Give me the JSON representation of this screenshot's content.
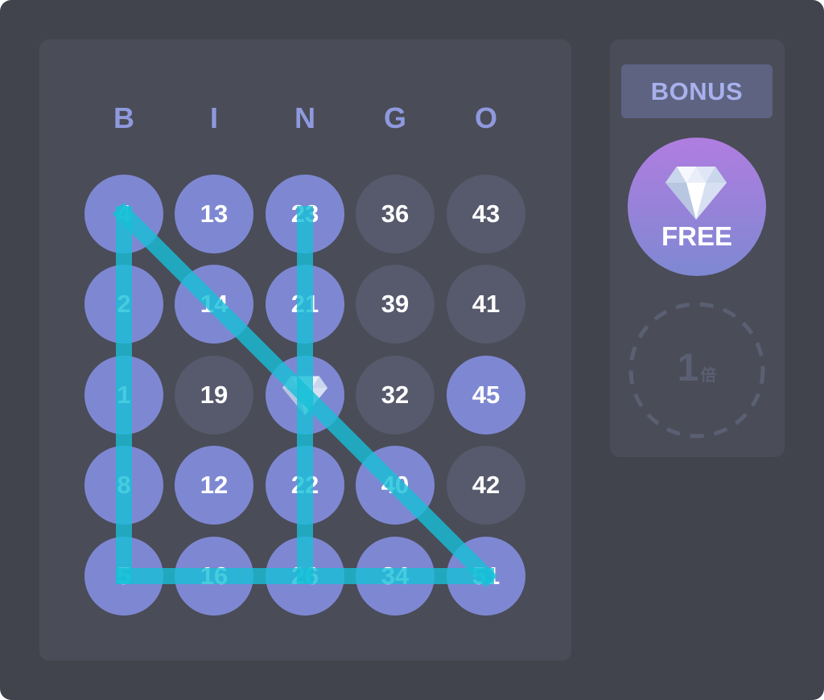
{
  "colors": {
    "frame_bg": "#42444d",
    "panel_bg": "#4a4c58",
    "marked_ball": "#7e88d2",
    "unmarked_ball": "#575a6c",
    "header_letter": "#8f99de",
    "win_line": "#17c0d8",
    "bonus_btn_bg": "#5d6381",
    "bonus_btn_text": "#a8b1ec",
    "free_gradient_top": "#b07de0",
    "free_gradient_bottom": "#7e88d2",
    "multiplier_dash": "#5a5f72"
  },
  "header": [
    "B",
    "I",
    "N",
    "G",
    "O"
  ],
  "grid": [
    [
      {
        "n": "4",
        "marked": true
      },
      {
        "n": "13",
        "marked": true
      },
      {
        "n": "23",
        "marked": true
      },
      {
        "n": "36",
        "marked": false
      },
      {
        "n": "43",
        "marked": false
      }
    ],
    [
      {
        "n": "2",
        "marked": true
      },
      {
        "n": "14",
        "marked": true
      },
      {
        "n": "21",
        "marked": true
      },
      {
        "n": "39",
        "marked": false
      },
      {
        "n": "41",
        "marked": false
      }
    ],
    [
      {
        "n": "1",
        "marked": true
      },
      {
        "n": "19",
        "marked": false
      },
      {
        "n": "",
        "marked": true,
        "free": true,
        "icon": "diamond-icon"
      },
      {
        "n": "32",
        "marked": false
      },
      {
        "n": "45",
        "marked": true
      }
    ],
    [
      {
        "n": "8",
        "marked": true
      },
      {
        "n": "12",
        "marked": true
      },
      {
        "n": "22",
        "marked": true
      },
      {
        "n": "40",
        "marked": true
      },
      {
        "n": "42",
        "marked": false
      }
    ],
    [
      {
        "n": "5",
        "marked": true
      },
      {
        "n": "16",
        "marked": true
      },
      {
        "n": "26",
        "marked": true
      },
      {
        "n": "34",
        "marked": true
      },
      {
        "n": "51",
        "marked": true
      }
    ]
  ],
  "bonus": {
    "button_label": "BONUS",
    "free_label": "FREE",
    "free_icon": "diamond-icon",
    "multiplier_value": "1",
    "multiplier_unit": "倍"
  }
}
